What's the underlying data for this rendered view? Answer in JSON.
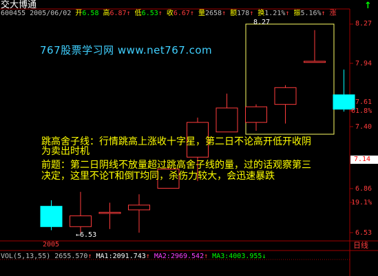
{
  "window": {
    "title": "交大博通",
    "up_arrow": "↑"
  },
  "quote": {
    "code_date": "600455 2005/06/02",
    "open_label": "开",
    "open": "6.58",
    "high_label": "高",
    "high": "6.87",
    "low_label": "低",
    "low": "6.53",
    "close_label": "收",
    "close": "6.67",
    "volume_label": "量",
    "volume": "2658",
    "amount_label": "额",
    "amount": "178",
    "turnover_label": "换",
    "turnover": "1.21%",
    "amplitude_label": "振",
    "amplitude": "5.16%",
    "change_label": "涨"
  },
  "watermark": "767股票学习网 www.net767.com",
  "annotation": {
    "line1": "跳高舍子线：行情跳高上涨收十字星，第二日不论高开低开收阴",
    "line2": "为卖出时机",
    "line3": "前题：第二日阴线不放量超过跳高舍子线的量，过的话观察第三",
    "line4": "决定，这里不论T和倒T均同，杀伤力较大，会迅速暴跌"
  },
  "price_axis": {
    "labels": [
      "8.27",
      "7.94",
      "7.61",
      "61.8%",
      "7.40",
      "6.86",
      "19.1%",
      "6.53"
    ],
    "current_price": "7.14"
  },
  "peak_label": "8.27",
  "low_marker": "←6.53",
  "date_label": "2005",
  "period_label": "日线",
  "volume_bar": {
    "vol_label": "VOL(5,13,55)",
    "vol": "2655.570",
    "ma1_label": "MA1:",
    "ma1": "2091.743",
    "ma2_label": "MA2:",
    "ma2": "2969.542",
    "ma3_label": "MA3:",
    "ma3": "4003.955"
  },
  "colors": {
    "up": "#ff3c3c",
    "down": "#00ffff",
    "text_red": "#ff3c3c",
    "text_green": "#00e000",
    "annotation": "#ffff00",
    "box": "#ffff66",
    "ma1": "#ffffff",
    "ma2": "#ff40ff",
    "ma3": "#00ff00"
  },
  "chart_data": {
    "type": "candlestick",
    "price_range": [
      6.53,
      8.27
    ],
    "candles": [
      {
        "open": 6.75,
        "high": 6.8,
        "low": 6.55,
        "close": 6.58
      },
      {
        "open": 6.58,
        "high": 6.87,
        "low": 6.53,
        "close": 6.67
      },
      {
        "open": 6.69,
        "high": 6.78,
        "low": 6.56,
        "close": 6.7
      },
      {
        "open": 6.72,
        "high": 6.85,
        "low": 6.53,
        "close": 6.76
      },
      {
        "open": 6.9,
        "high": 7.08,
        "low": 6.9,
        "close": 7.06
      },
      {
        "open": 7.16,
        "high": 7.49,
        "low": 6.96,
        "close": 7.45
      },
      {
        "open": 7.37,
        "high": 7.69,
        "low": 7.37,
        "close": 7.57
      },
      {
        "open": 7.45,
        "high": 7.6,
        "low": 7.38,
        "close": 7.58
      },
      {
        "open": 7.6,
        "high": 7.76,
        "low": 7.44,
        "close": 7.74
      },
      {
        "open": 7.95,
        "high": 8.22,
        "low": 7.96,
        "close": 7.96
      },
      {
        "open": 7.68,
        "high": 7.89,
        "low": 7.54,
        "close": 7.56
      }
    ]
  }
}
